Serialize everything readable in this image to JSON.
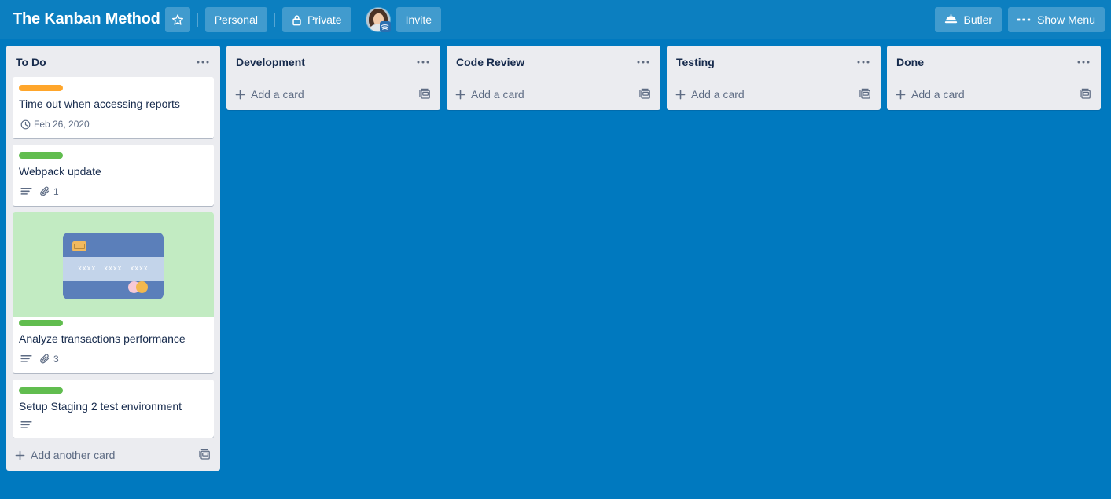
{
  "header": {
    "board_title": "The Kanban Method",
    "star_icon": "star-icon",
    "visibility_team": "Personal",
    "visibility_privacy": "Private",
    "privacy_icon": "lock-icon",
    "invite_label": "Invite",
    "avatar_name": "member-avatar",
    "butler_label": "Butler",
    "butler_icon": "butler-bell-icon",
    "show_menu_label": "Show Menu",
    "show_menu_icon": "ellipsis-icon",
    "background_color": "#0079bf",
    "bar_color": "#0c7fc0"
  },
  "colors": {
    "label_orange": "#ffa62b",
    "label_green": "#61bd4f",
    "cover_green": "#c2ebc2",
    "list_bg": "#ebecf0",
    "card_bg": "#ffffff",
    "text_dark": "#172b4d",
    "text_muted": "#5e6c84"
  },
  "lists": [
    {
      "title": "To Do",
      "menu_icon": "list-menu-icon",
      "add_card_label": "Add another card",
      "template_icon": "card-template-icon",
      "cards": [
        {
          "title": "Time out when accessing reports",
          "labels": [
            "#ffa62b"
          ],
          "cover": null,
          "badges": [
            {
              "type": "due-date",
              "icon": "clock-icon",
              "text": "Feb 26, 2020"
            }
          ]
        },
        {
          "title": "Webpack update",
          "labels": [
            "#61bd4f"
          ],
          "cover": null,
          "badges": [
            {
              "type": "description",
              "icon": "description-icon",
              "text": ""
            },
            {
              "type": "attachment",
              "icon": "paperclip-icon",
              "text": "1"
            }
          ]
        },
        {
          "title": "Analyze transactions performance",
          "labels": [
            "#61bd4f"
          ],
          "cover": "credit-card-illustration",
          "badges": [
            {
              "type": "description",
              "icon": "description-icon",
              "text": ""
            },
            {
              "type": "attachment",
              "icon": "paperclip-icon",
              "text": "3"
            }
          ]
        },
        {
          "title": "Setup Staging 2 test environment",
          "labels": [
            "#61bd4f"
          ],
          "cover": null,
          "badges": [
            {
              "type": "description",
              "icon": "description-icon",
              "text": ""
            }
          ]
        }
      ]
    },
    {
      "title": "Development",
      "menu_icon": "list-menu-icon",
      "add_card_label": "Add a card",
      "template_icon": "card-template-icon",
      "cards": []
    },
    {
      "title": "Code Review",
      "menu_icon": "list-menu-icon",
      "add_card_label": "Add a card",
      "template_icon": "card-template-icon",
      "cards": []
    },
    {
      "title": "Testing",
      "menu_icon": "list-menu-icon",
      "add_card_label": "Add a card",
      "template_icon": "card-template-icon",
      "cards": []
    },
    {
      "title": "Done",
      "menu_icon": "list-menu-icon",
      "add_card_label": "Add a card",
      "template_icon": "card-template-icon",
      "cards": []
    }
  ],
  "card_cover_art": {
    "name": "credit-card-illustration",
    "card_number_groups": [
      "xxxx",
      "xxxx",
      "xxxx"
    ],
    "chip_color": "#f2b95e",
    "body_color": "#5b7fba",
    "stripe_color": "#c3d4ea",
    "dot_left_color": "#f7c9d7",
    "dot_right_color": "#f3b84e"
  }
}
